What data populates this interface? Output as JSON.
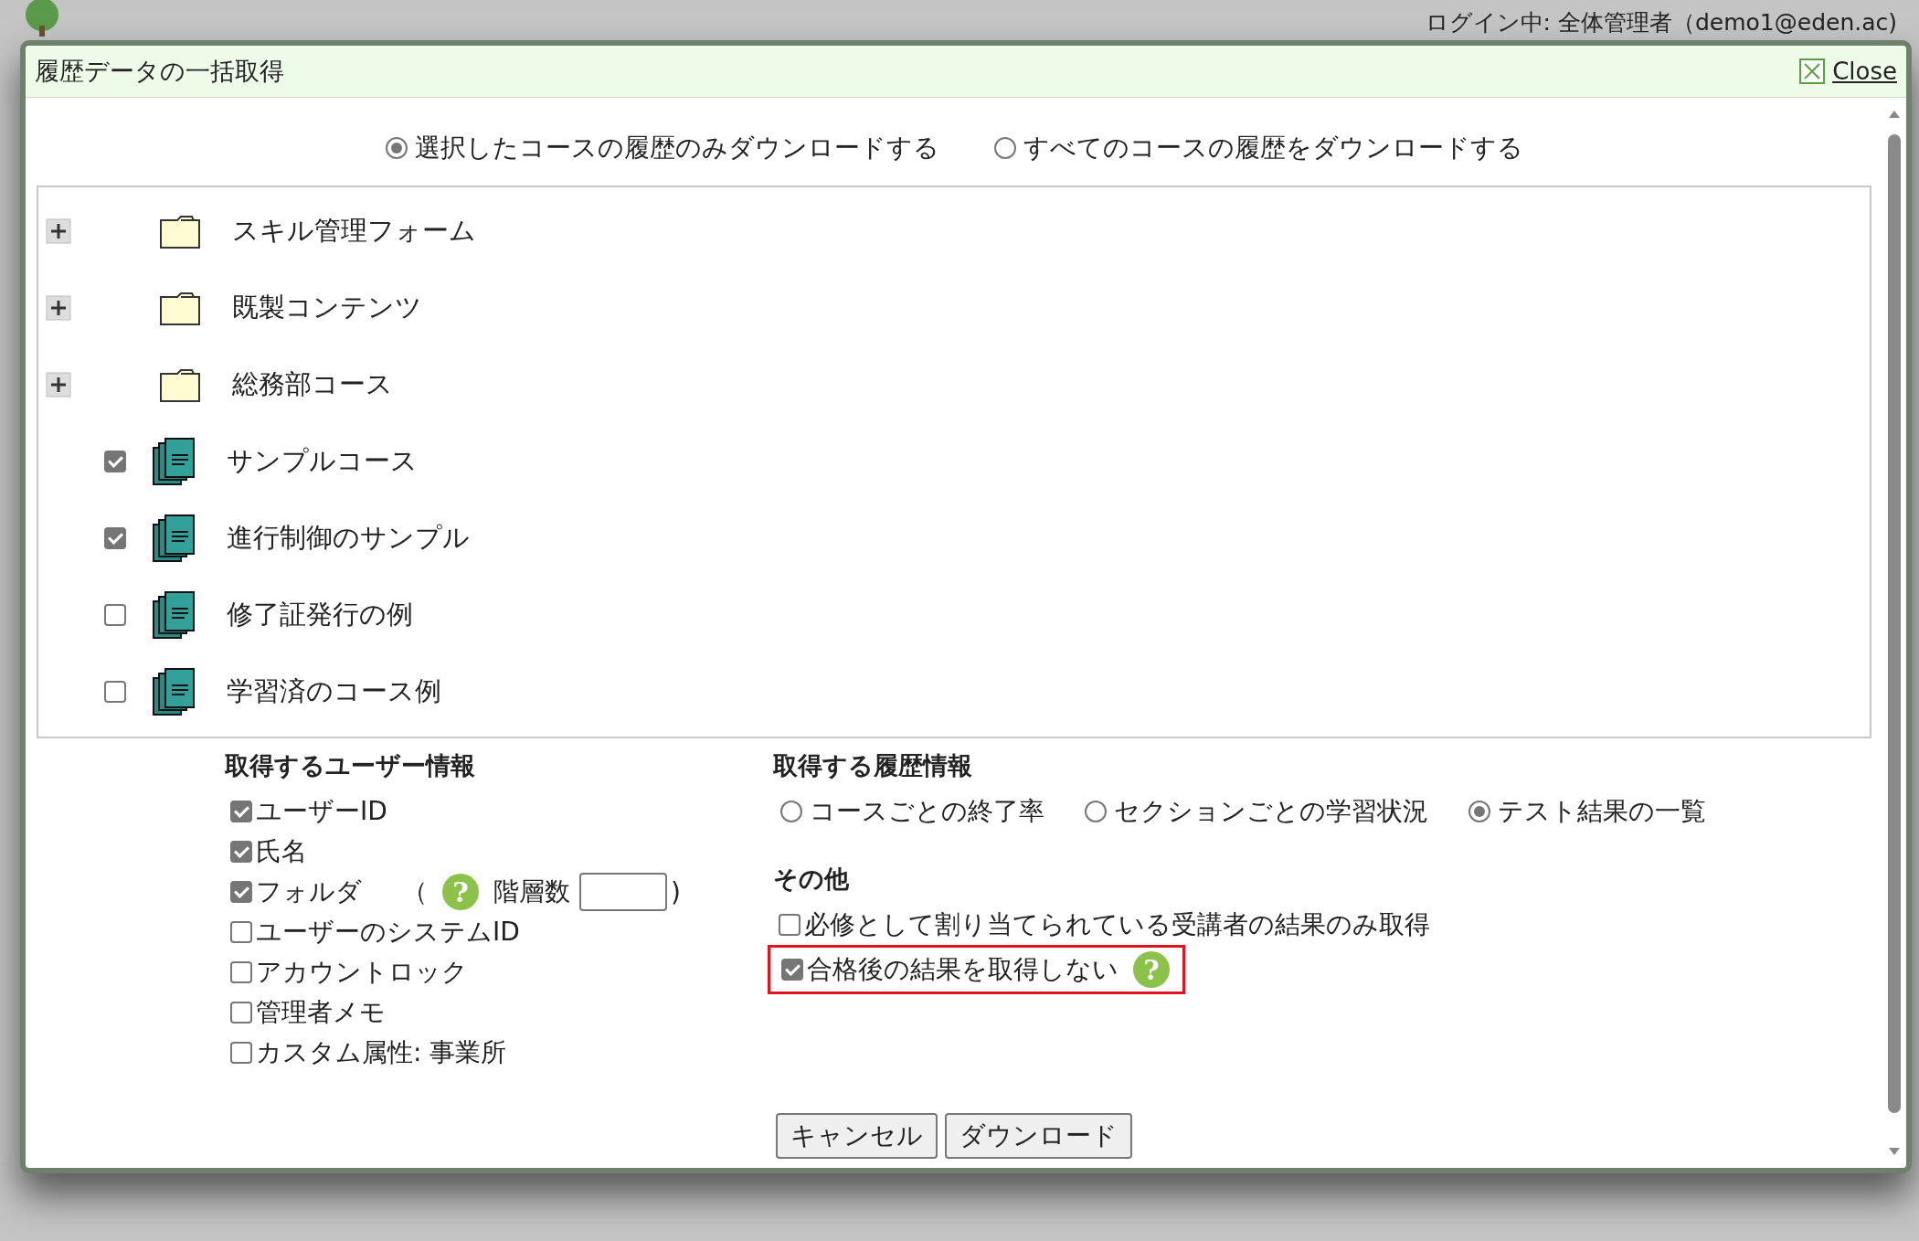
{
  "header": {
    "login": "ログイン中: 全体管理者（demo1@eden.ac)"
  },
  "dialog": {
    "title": "履歴データの一括取得",
    "close": "Close"
  },
  "scope_options": [
    {
      "label": "選択したコースの履歴のみダウンロードする",
      "selected": true
    },
    {
      "label": "すべてのコースの履歴をダウンロードする",
      "selected": false
    }
  ],
  "tree": [
    {
      "kind": "folder",
      "label": "スキル管理フォーム",
      "expanded": false
    },
    {
      "kind": "folder",
      "label": "既製コンテンツ",
      "expanded": false
    },
    {
      "kind": "folder",
      "label": "総務部コース",
      "expanded": false
    },
    {
      "kind": "course",
      "label": "サンプルコース",
      "checked": true
    },
    {
      "kind": "course",
      "label": "進行制御のサンプル",
      "checked": true
    },
    {
      "kind": "course",
      "label": "修了証発行の例",
      "checked": false
    },
    {
      "kind": "course",
      "label": "学習済のコース例",
      "checked": false
    }
  ],
  "user_info": {
    "heading": "取得するユーザー情報",
    "options": [
      {
        "kind": "plain",
        "label": "ユーザーID",
        "checked": true
      },
      {
        "kind": "plain",
        "label": "氏名",
        "checked": true
      },
      {
        "kind": "depth",
        "label": "フォルダ",
        "checked": true,
        "open_paren": "（",
        "help": "?",
        "depth_label": "階層数",
        "close_paren": ")"
      },
      {
        "kind": "plain",
        "label": "ユーザーのシステムID",
        "checked": false
      },
      {
        "kind": "plain",
        "label": "アカウントロック",
        "checked": false
      },
      {
        "kind": "plain",
        "label": "管理者メモ",
        "checked": false
      },
      {
        "kind": "plain",
        "label": "カスタム属性: 事業所",
        "checked": false
      }
    ]
  },
  "history_info": {
    "heading": "取得する履歴情報",
    "options": [
      {
        "label": "コースごとの終了率",
        "selected": false
      },
      {
        "label": "セクションごとの学習状況",
        "selected": false
      },
      {
        "label": "テスト結果の一覧",
        "selected": true
      }
    ]
  },
  "other": {
    "heading": "その他",
    "options": [
      {
        "label": "必修として割り当てられている受講者の結果のみ取得",
        "checked": false,
        "highlighted": false
      },
      {
        "label": "合格後の結果を取得しない",
        "checked": true,
        "highlighted": true,
        "help": "?"
      }
    ]
  },
  "buttons": [
    "キャンセル",
    "ダウンロード"
  ]
}
